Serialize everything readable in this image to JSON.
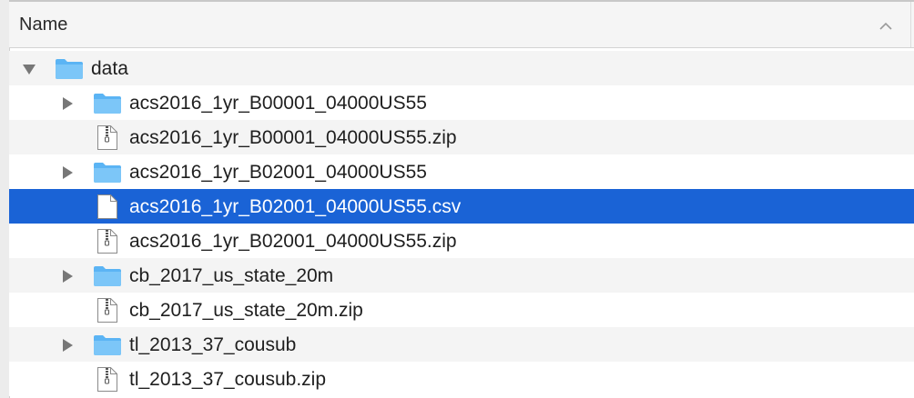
{
  "header": {
    "column_name": "Name",
    "sort_direction": "ascending"
  },
  "colors": {
    "selection": "#1a63d6",
    "folder": "#5bb4f4",
    "stripe": "#f4f4f4"
  },
  "root": {
    "name": "data",
    "expanded": true,
    "icon": "folder-icon"
  },
  "items": [
    {
      "name": "acs2016_1yr_B00001_04000US55",
      "kind": "folder",
      "icon": "folder-icon",
      "expanded": false
    },
    {
      "name": "acs2016_1yr_B00001_04000US55.zip",
      "kind": "zip",
      "icon": "zip-file-icon"
    },
    {
      "name": "acs2016_1yr_B02001_04000US55",
      "kind": "folder",
      "icon": "folder-icon",
      "expanded": false
    },
    {
      "name": "acs2016_1yr_B02001_04000US55.csv",
      "kind": "file",
      "icon": "document-icon",
      "selected": true
    },
    {
      "name": "acs2016_1yr_B02001_04000US55.zip",
      "kind": "zip",
      "icon": "zip-file-icon"
    },
    {
      "name": "cb_2017_us_state_20m",
      "kind": "folder",
      "icon": "folder-icon",
      "expanded": false
    },
    {
      "name": "cb_2017_us_state_20m.zip",
      "kind": "zip",
      "icon": "zip-file-icon"
    },
    {
      "name": "tl_2013_37_cousub",
      "kind": "folder",
      "icon": "folder-icon",
      "expanded": false
    },
    {
      "name": "tl_2013_37_cousub.zip",
      "kind": "zip",
      "icon": "zip-file-icon"
    }
  ]
}
